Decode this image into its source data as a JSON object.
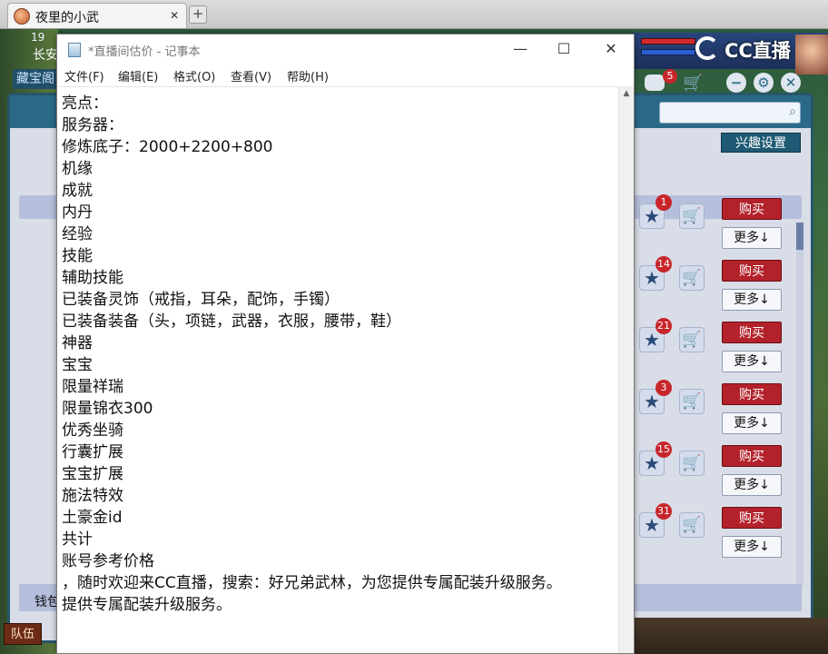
{
  "browser": {
    "tab_title": "夜里的小武",
    "tab_close": "✕",
    "new_tab": "+"
  },
  "game": {
    "time_text": "19",
    "area_text": "长安",
    "left_panel_label": "藏宝阁",
    "cc_brand": "CC直播",
    "message_count": "5",
    "interest_button": "兴趣设置",
    "wallet_label": "钱包",
    "team_label": "队伍",
    "items": [
      {
        "badge": "1",
        "buy": "购买",
        "more": "更多↓"
      },
      {
        "badge": "14",
        "buy": "购买",
        "more": "更多↓"
      },
      {
        "badge": "21",
        "buy": "购买",
        "more": "更多↓"
      },
      {
        "badge": "3",
        "buy": "购买",
        "more": "更多↓"
      },
      {
        "badge": "15",
        "buy": "购买",
        "more": "更多↓"
      },
      {
        "badge": "31",
        "buy": "购买",
        "more": "更多↓"
      }
    ]
  },
  "notepad": {
    "title": "*直播间估价 - 记事本",
    "minimize": "—",
    "maximize": "☐",
    "close": "✕",
    "menu": [
      "文件(F)",
      "编辑(E)",
      "格式(O)",
      "查看(V)",
      "帮助(H)"
    ],
    "lines": [
      "亮点：",
      "服务器：",
      "修炼底子：2000+2200+800",
      "机缘",
      "成就",
      "内丹",
      "经验",
      "技能",
      "辅助技能",
      "已装备灵饰（戒指，耳朵，配饰，手镯）",
      "已装备装备（头，项链，武器，衣服，腰带，鞋）",
      "神器",
      "宝宝",
      "限量祥瑞",
      "限量锦衣300",
      "优秀坐骑",
      "行囊扩展",
      "宝宝扩展",
      "施法特效",
      "土豪金id",
      "共计",
      "账号参考价格",
      "，随时欢迎来CC直播，搜索：好兄弟武林，为您提供专属配装升级服务。",
      "提供专属配装升级服务。"
    ]
  }
}
